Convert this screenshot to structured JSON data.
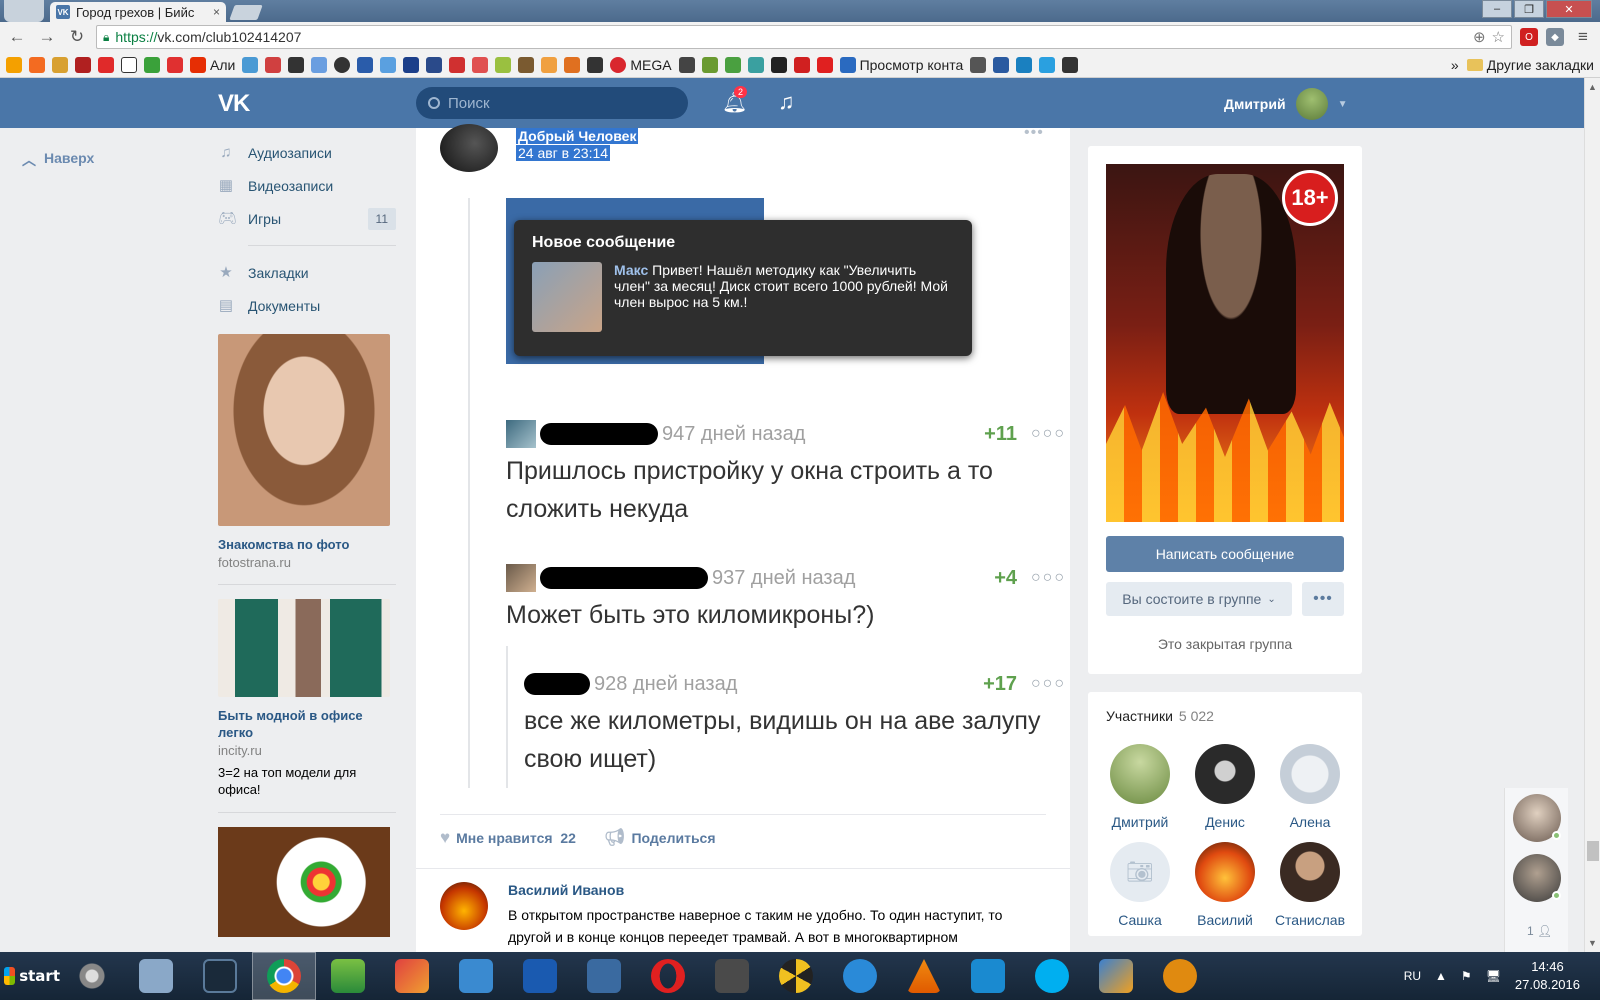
{
  "browser": {
    "tab_title": "Город грехов | Бийс",
    "tab_favicon": "vk-favicon",
    "tab_close": "×",
    "url_protocol": "https://",
    "url_rest": "vk.com/club102414207",
    "bookmarks": {
      "ali": "Али",
      "mega": "MEGA",
      "contacts": "Просмотр конта",
      "other": "Другие закладки",
      "more": "»"
    }
  },
  "vk_header": {
    "logo": "VK",
    "search_placeholder": "Поиск",
    "notif_count": "2",
    "user_name": "Дмитрий"
  },
  "left": {
    "up_label": "Наверх",
    "nav": [
      {
        "label": "Аудиозаписи",
        "icon": "music-icon"
      },
      {
        "label": "Видеозаписи",
        "icon": "film-icon"
      },
      {
        "label": "Игры",
        "icon": "gamepad-icon",
        "count": "11"
      },
      {
        "label": "Закладки",
        "icon": "star-icon"
      },
      {
        "label": "Документы",
        "icon": "document-icon"
      }
    ],
    "ads": [
      {
        "title": "Знакомства по фото",
        "domain": "fotostrana.ru"
      },
      {
        "title": "Быть модной в офисе легко",
        "domain": "incity.ru",
        "desc": "3=2 на топ модели для офиса!"
      }
    ]
  },
  "post": {
    "author": "Добрый Человек",
    "date": "24 авг в 23:14",
    "screenshot": {
      "notif_title": "Новое сообщение",
      "notif_sender": "Макс",
      "notif_text": "Привет! Нашёл методику как \"Увеличить член\" за месяц! Диск стоит всего 1000 рублей! Мой член вырос на 5 км.!",
      "comments": [
        {
          "ago": "947 дней назад",
          "score": "+11",
          "text": "Пришлось пристройку у окна строить а то сложить некуда"
        },
        {
          "ago": "937 дней назад",
          "score": "+4",
          "text": "Может быть это киломикроны?)"
        },
        {
          "ago": "928 дней назад",
          "score": "+17",
          "text": "все же километры, видишь он на аве залупу свою ищет)"
        }
      ]
    },
    "likes_label": "Мне нравится",
    "likes_count": "22",
    "share_label": "Поделиться",
    "comment": {
      "author": "Василий Иванов",
      "text": "В открытом пространстве наверное с таким не удобно. То один наступит, то другой и в конце концов переедет трамвай. А вот в многоквартирном"
    }
  },
  "right": {
    "badge": "18+",
    "write_message": "Написать сообщение",
    "member_status": "Вы состоите в группе",
    "closed_group": "Это закрытая группа",
    "members_title": "Участники",
    "members_count": "5 022",
    "members": [
      {
        "name": "Дмитрий"
      },
      {
        "name": "Денис"
      },
      {
        "name": "Алена"
      },
      {
        "name": "Сашка"
      },
      {
        "name": "Василий"
      },
      {
        "name": "Станислав"
      }
    ]
  },
  "chat": {
    "online_count": "1"
  },
  "taskbar": {
    "start": "start",
    "lang": "RU",
    "time": "14:46",
    "date": "27.08.2016"
  }
}
